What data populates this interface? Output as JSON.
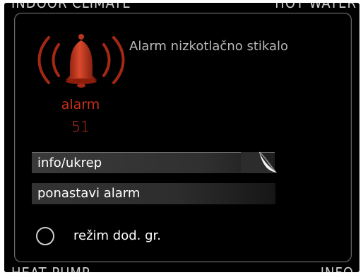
{
  "background_tabs": {
    "top_left": "INDOOR CLIMATE",
    "top_right": "HOT WATER",
    "bottom_left": "HEAT PUMP",
    "bottom_right": "INFO"
  },
  "alarm": {
    "title": "Alarm nizkotlačno stikalo",
    "label": "alarm",
    "code": "51",
    "icon": "alarm-bell-icon",
    "color": "#c8321c"
  },
  "menu": {
    "info_label": "info/ukrep",
    "reset_label": "ponastavi alarm",
    "aid_mode_label": "režim dod. gr."
  },
  "colors": {
    "screen_bg": "#000000",
    "text": "#ffffff",
    "muted_text": "#b9b9b9"
  }
}
